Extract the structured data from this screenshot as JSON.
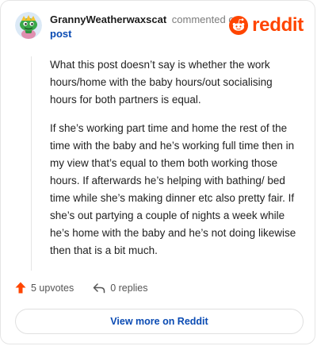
{
  "header": {
    "username": "GrannyWeatherwaxscat",
    "action_text": "commented on",
    "post_link": "post",
    "brand_word": "reddit",
    "avatar_icon": "snoo-avatar-icon",
    "brand_icon": "reddit-logo-icon"
  },
  "comment": {
    "paragraphs": [
      "What this post doesn’t say is whether the work hours/home with the baby hours/out socialising hours for both partners is equal.",
      "If she’s working part time and home the rest of the time with the baby and he’s working full time then in my view that’s equal to them both working those hours. If afterwards he’s helping with bathing/ bed time while she’s making dinner etc also pretty fair. If she’s out partying a couple of nights a week while he’s home with the baby and he’s not doing likewise then that is a bit much."
    ]
  },
  "footer": {
    "upvotes_label": "5 upvotes",
    "replies_label": "0 replies",
    "upvote_icon": "upvote-arrow-icon",
    "reply_icon": "reply-arrow-icon"
  },
  "cta": {
    "label": "View more on Reddit"
  },
  "colors": {
    "brand": "#ff4500",
    "link": "#0a4bb3",
    "border": "#e5e5e5",
    "muted": "#7c7c7c"
  }
}
